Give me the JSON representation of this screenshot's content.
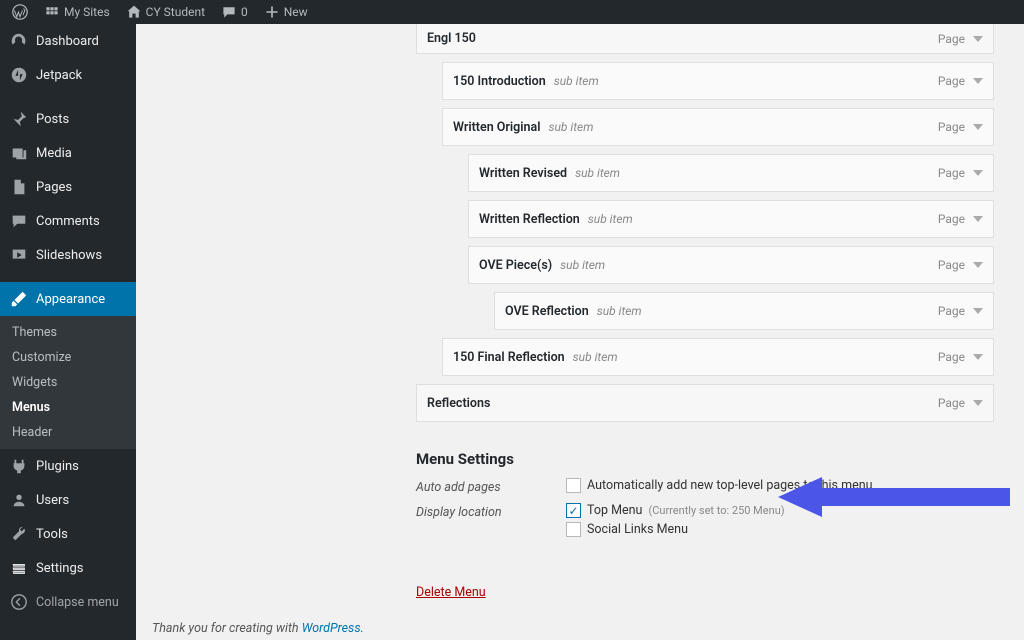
{
  "toolbar": {
    "my_sites": "My Sites",
    "site_name": "CY Student",
    "comments": "0",
    "new": "New"
  },
  "sidebar": {
    "items": [
      {
        "label": "Dashboard",
        "icon": "dashboard"
      },
      {
        "label": "Jetpack",
        "icon": "jetpack"
      },
      {
        "label": "Posts",
        "icon": "pin"
      },
      {
        "label": "Media",
        "icon": "media"
      },
      {
        "label": "Pages",
        "icon": "pages"
      },
      {
        "label": "Comments",
        "icon": "comments"
      },
      {
        "label": "Slideshows",
        "icon": "slides"
      },
      {
        "label": "Appearance",
        "icon": "brush"
      },
      {
        "label": "Plugins",
        "icon": "plug"
      },
      {
        "label": "Users",
        "icon": "users"
      },
      {
        "label": "Tools",
        "icon": "tools"
      },
      {
        "label": "Settings",
        "icon": "settings"
      }
    ],
    "appearance_sub": [
      {
        "label": "Themes"
      },
      {
        "label": "Customize"
      },
      {
        "label": "Widgets"
      },
      {
        "label": "Menus"
      },
      {
        "label": "Header"
      }
    ],
    "collapse": "Collapse menu"
  },
  "menu_items": [
    {
      "title": "Engl 150",
      "sub": "",
      "type": "Page",
      "indent": 0,
      "cut": true
    },
    {
      "title": "150 Introduction",
      "sub": "sub item",
      "type": "Page",
      "indent": 1
    },
    {
      "title": "Written Original",
      "sub": "sub item",
      "type": "Page",
      "indent": 1
    },
    {
      "title": "Written Revised",
      "sub": "sub item",
      "type": "Page",
      "indent": 2
    },
    {
      "title": "Written Reflection",
      "sub": "sub item",
      "type": "Page",
      "indent": 2
    },
    {
      "title": "OVE Piece(s)",
      "sub": "sub item",
      "type": "Page",
      "indent": 2
    },
    {
      "title": "OVE Reflection",
      "sub": "sub item",
      "type": "Page",
      "indent": 3
    },
    {
      "title": "150 Final Reflection",
      "sub": "sub item",
      "type": "Page",
      "indent": 1
    },
    {
      "title": "Reflections",
      "sub": "",
      "type": "Page",
      "indent": 0
    }
  ],
  "settings": {
    "heading": "Menu Settings",
    "auto_add_label": "Auto add pages",
    "auto_add_checkbox": "Automatically add new top-level pages to this menu",
    "display_location_label": "Display location",
    "top_menu": "Top Menu",
    "top_menu_hint": "(Currently set to: 250 Menu)",
    "social_links": "Social Links Menu",
    "delete": "Delete Menu"
  },
  "footer": {
    "text": "Thank you for creating with ",
    "link": "WordPress."
  }
}
